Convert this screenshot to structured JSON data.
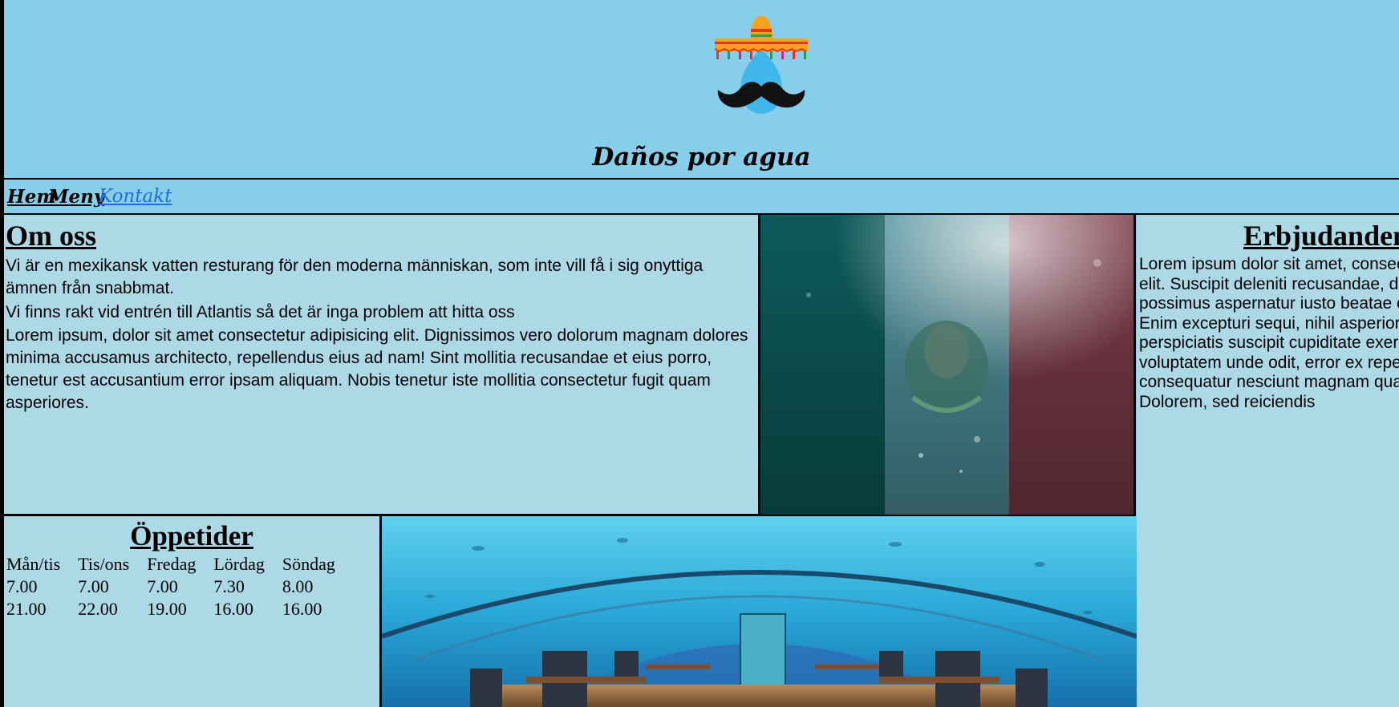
{
  "header": {
    "title": "Daños por agua",
    "logo_icon": "sombrero-mustache-logo-icon"
  },
  "nav": {
    "items": [
      {
        "label": "Hem"
      },
      {
        "label": "Meny"
      },
      {
        "label": "Kontakt",
        "active": true
      }
    ]
  },
  "about": {
    "heading": "Om oss",
    "paragraphs": [
      "Vi är en mexikansk vatten resturang för den moderna människan, som inte vill få i sig onyttiga ämnen från snabbmat.",
      "Vi finns rakt vid entrén till Atlantis så det är inga problem att hitta oss",
      "Lorem ipsum, dolor sit amet consectetur adipisicing elit. Dignissimos vero dolorum magnam dolores minima accusamus architecto, repellendus eius ad nam! Sint mollitia recusandae et eius porro, tenetur est accusantium error ipsam aliquam. Nobis tenetur iste mollitia consectetur fugit quam asperiores."
    ]
  },
  "offers": {
    "heading": "Erbjudanden",
    "text": "Lorem ipsum dolor sit amet, consectetur adipisicing elit. Suscipit deleniti recusandae, debitis nemo, possimus aspernatur iusto beatae cumque odio. Enim excepturi sequi, nihil asperiores quis perspiciatis suscipit cupiditate exercitationem voluptatem unde odit, error ex repellendus deleniti consequatur nesciunt magnam quaerat fuga itaque. Dolorem, sed reiciendis"
  },
  "hours": {
    "heading": "Öppetider",
    "days": [
      "Mån/tis",
      "Tis/ons",
      "Fredag",
      "Lördag",
      "Söndag"
    ],
    "open": [
      "7.00",
      "7.00",
      "7.00",
      "7.30",
      "8.00"
    ],
    "close": [
      "21.00",
      "22.00",
      "19.00",
      "16.00",
      "16.00"
    ]
  },
  "colors": {
    "page_bg": "#87ceeb",
    "panel_bg": "#add8e6",
    "active_link": "#1e6fd9"
  }
}
